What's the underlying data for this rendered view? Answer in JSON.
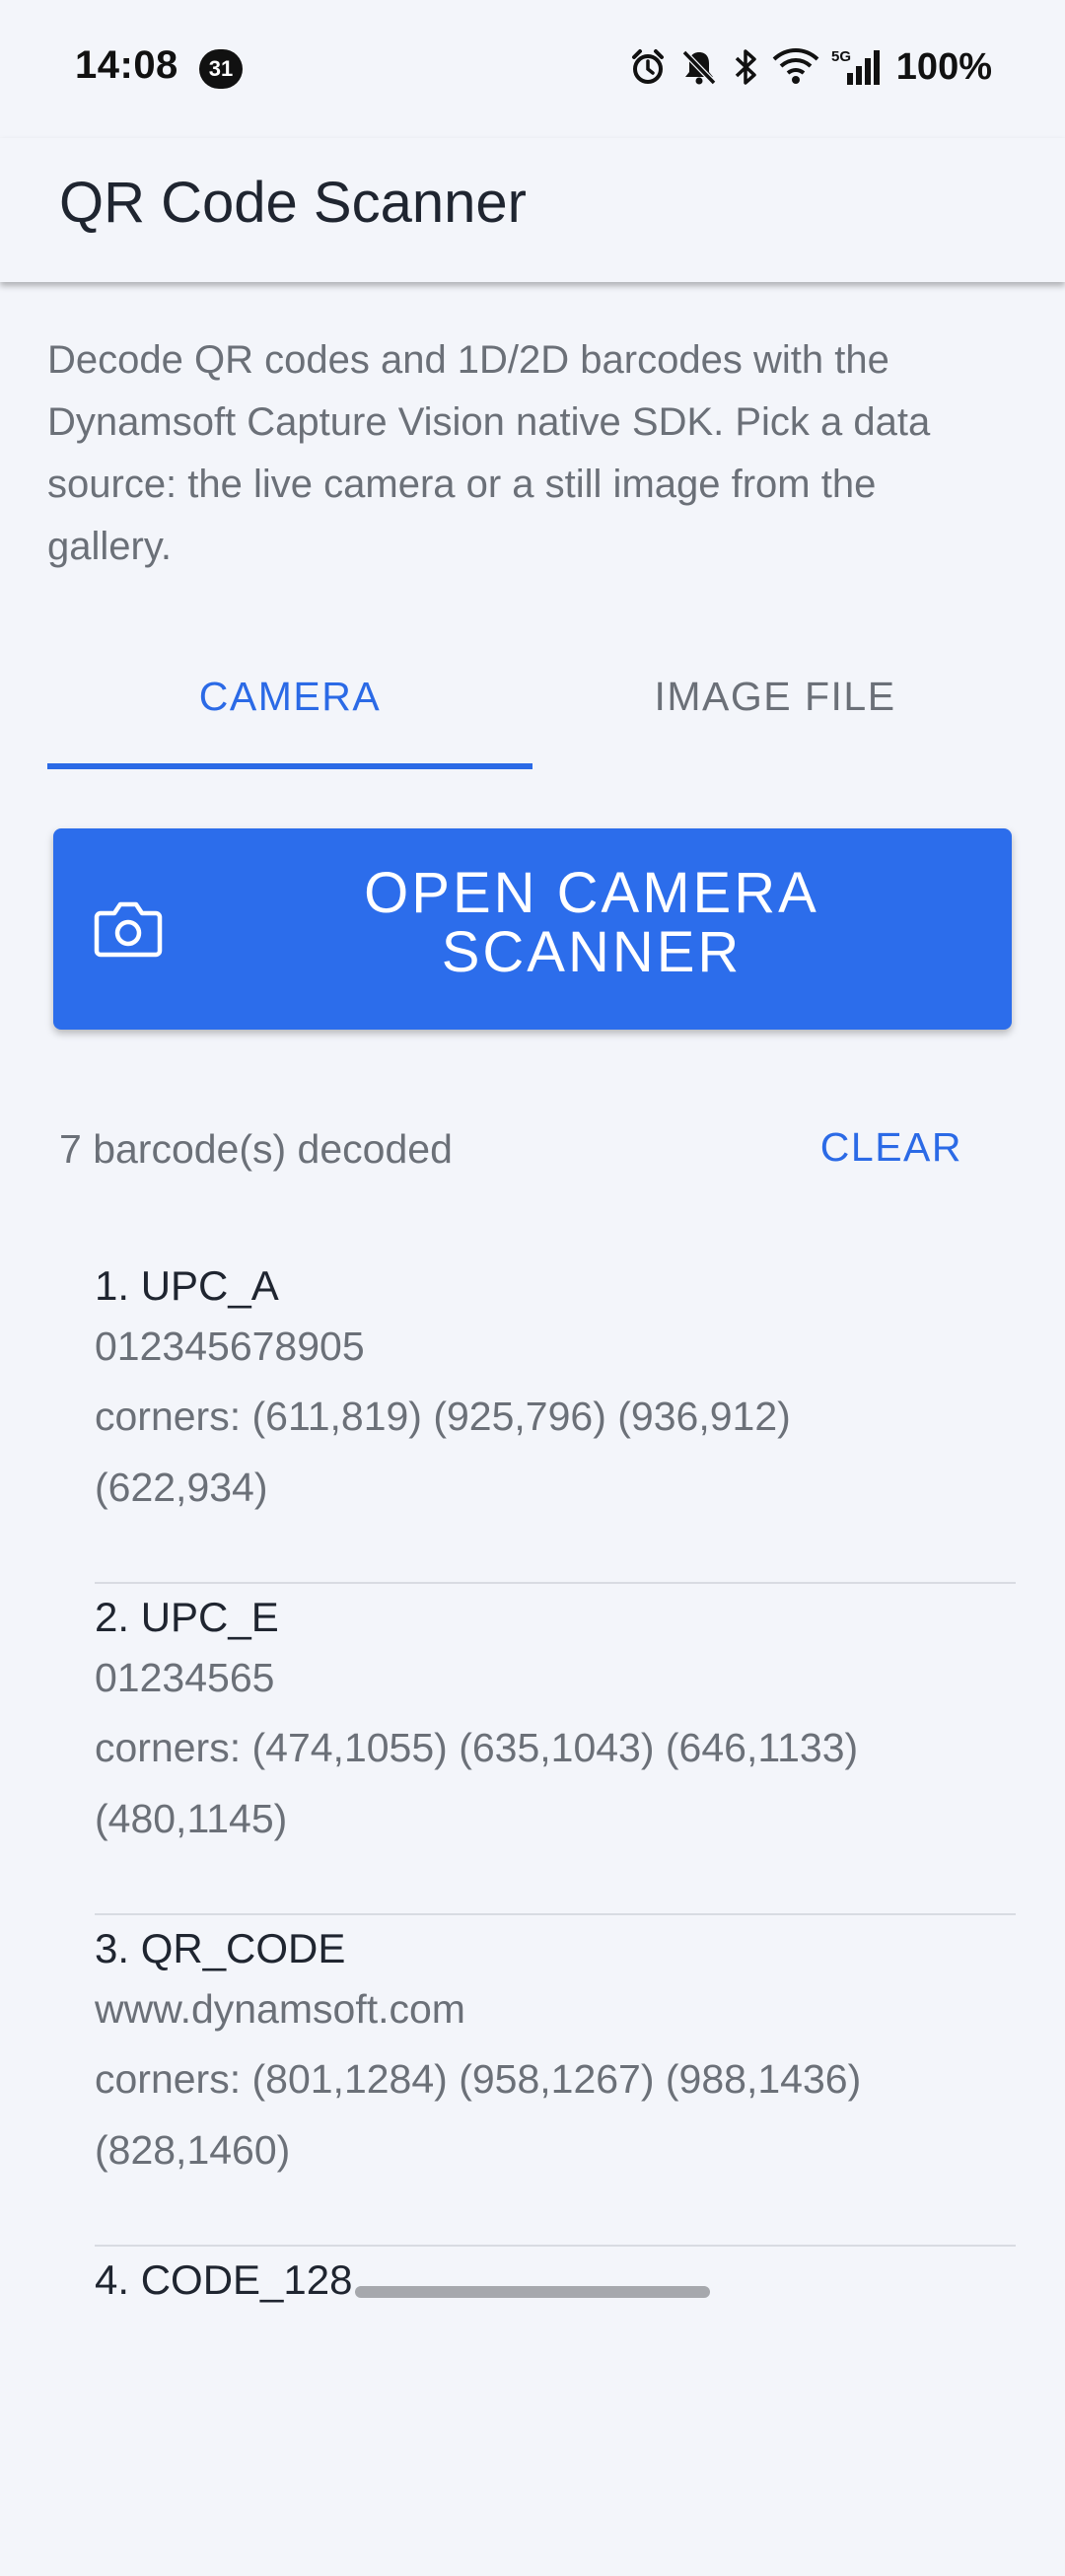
{
  "status_bar": {
    "time": "14:08",
    "calendar_badge": "31",
    "network_label": "5G",
    "battery": "100%"
  },
  "app_bar": {
    "title": "QR Code Scanner"
  },
  "description": "Decode QR codes and 1D/2D barcodes with the Dynamsoft Capture Vision native SDK. Pick a data source: the live camera or a still image from the gallery.",
  "tabs": [
    {
      "label": "CAMERA",
      "selected": true
    },
    {
      "label": "IMAGE FILE",
      "selected": false
    }
  ],
  "open_button": {
    "label": "OPEN CAMERA\nSCANNER",
    "icon": "camera-icon"
  },
  "results": {
    "count_text": "7 barcode(s) decoded",
    "clear_label": "CLEAR",
    "items": [
      {
        "title": "1. UPC_A",
        "value": "012345678905",
        "corners": "corners: (611,819) (925,796) (936,912) (622,934)"
      },
      {
        "title": "2. UPC_E",
        "value": "01234565",
        "corners": "corners: (474,1055) (635,1043) (646,1133) (480,1145)"
      },
      {
        "title": "3. QR_CODE",
        "value": "www.dynamsoft.com",
        "corners": "corners: (801,1284) (958,1267) (988,1436) (828,1460)"
      },
      {
        "title": "4. CODE_128",
        "value": "",
        "corners": ""
      }
    ]
  },
  "colors": {
    "accent": "#2b6ae6",
    "button": "#2c6deb",
    "background": "#f3f5fa",
    "secondary_text": "#6b7078"
  }
}
